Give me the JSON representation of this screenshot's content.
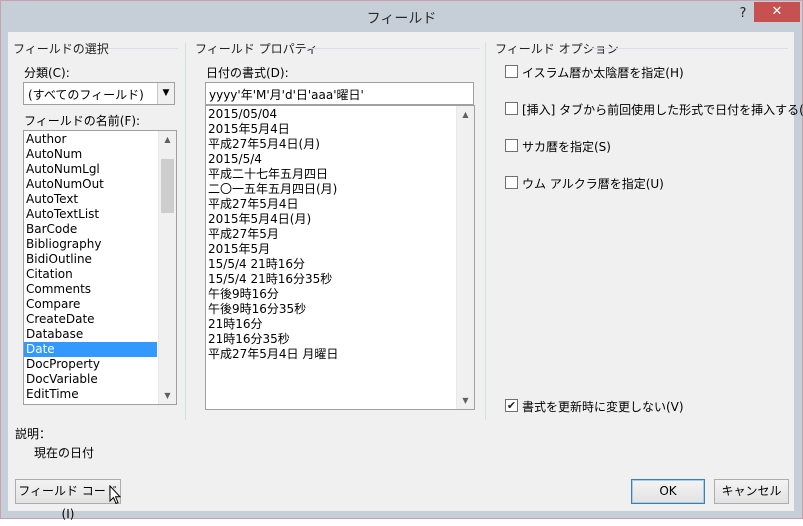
{
  "dialog": {
    "title": "フィールド",
    "help": "?",
    "close": "✕"
  },
  "left": {
    "group_title": "フィールドの選択",
    "category_label": "分類(C):",
    "category_value": "(すべてのフィールド)",
    "names_label": "フィールドの名前(F):",
    "field_names": [
      "Author",
      "AutoNum",
      "AutoNumLgl",
      "AutoNumOut",
      "AutoText",
      "AutoTextList",
      "BarCode",
      "Bibliography",
      "BidiOutline",
      "Citation",
      "Comments",
      "Compare",
      "CreateDate",
      "Database",
      "Date",
      "DocProperty",
      "DocVariable",
      "EditTime"
    ],
    "selected": "Date"
  },
  "middle": {
    "group_title": "フィールド プロパティ",
    "format_label": "日付の書式(D):",
    "format_value": "yyyy'年'M'月'd'日'aaa'曜日'",
    "formats": [
      "2015/05/04",
      "2015年5月4日",
      "平成27年5月4日(月)",
      "2015/5/4",
      "平成二十七年五月四日",
      "二〇一五年五月四日(月)",
      "平成27年5月4日",
      "2015年5月4日(月)",
      "平成27年5月",
      "2015年5月",
      "15/5/4 21時16分",
      "15/5/4 21時16分35秒",
      "午後9時16分",
      "午後9時16分35秒",
      "21時16分",
      "21時16分35秒",
      "平成27年5月4日 月曜日"
    ]
  },
  "right": {
    "group_title": "フィールド オプション",
    "options": [
      {
        "label": "イスラム暦か太陰暦を指定(H)",
        "checked": false
      },
      {
        "label": "[挿入] タブから前回使用した形式で日付を挿入する(L)",
        "checked": false
      },
      {
        "label": "サカ暦を指定(S)",
        "checked": false
      },
      {
        "label": "ウム アルクラ暦を指定(U)",
        "checked": false
      }
    ],
    "preserve_label": "書式を更新時に変更しない(V)",
    "preserve_checked": true
  },
  "description": {
    "label": "説明：",
    "text": "現在の日付"
  },
  "buttons": {
    "field_codes": "フィールド コード(I)",
    "ok": "OK",
    "cancel": "キャンセル"
  }
}
